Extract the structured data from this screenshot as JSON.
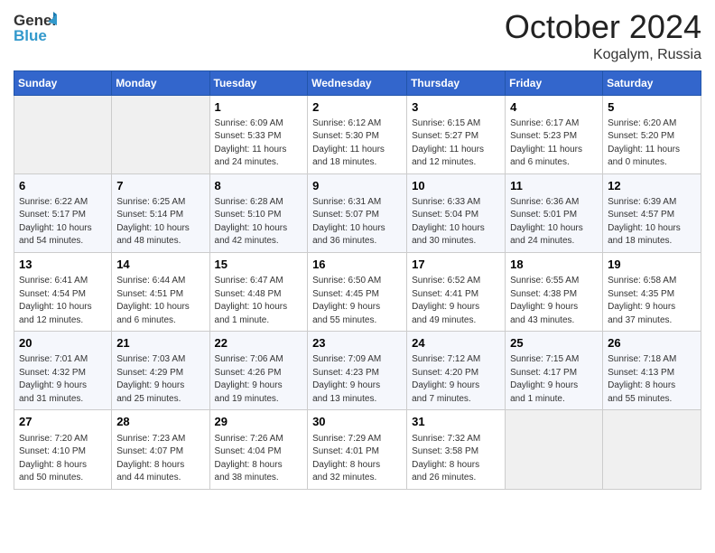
{
  "header": {
    "logo_general": "General",
    "logo_blue": "Blue",
    "month_title": "October 2024",
    "location": "Kogalym, Russia"
  },
  "weekdays": [
    "Sunday",
    "Monday",
    "Tuesday",
    "Wednesday",
    "Thursday",
    "Friday",
    "Saturday"
  ],
  "weeks": [
    [
      {
        "day": "",
        "detail": ""
      },
      {
        "day": "",
        "detail": ""
      },
      {
        "day": "1",
        "detail": "Sunrise: 6:09 AM\nSunset: 5:33 PM\nDaylight: 11 hours\nand 24 minutes."
      },
      {
        "day": "2",
        "detail": "Sunrise: 6:12 AM\nSunset: 5:30 PM\nDaylight: 11 hours\nand 18 minutes."
      },
      {
        "day": "3",
        "detail": "Sunrise: 6:15 AM\nSunset: 5:27 PM\nDaylight: 11 hours\nand 12 minutes."
      },
      {
        "day": "4",
        "detail": "Sunrise: 6:17 AM\nSunset: 5:23 PM\nDaylight: 11 hours\nand 6 minutes."
      },
      {
        "day": "5",
        "detail": "Sunrise: 6:20 AM\nSunset: 5:20 PM\nDaylight: 11 hours\nand 0 minutes."
      }
    ],
    [
      {
        "day": "6",
        "detail": "Sunrise: 6:22 AM\nSunset: 5:17 PM\nDaylight: 10 hours\nand 54 minutes."
      },
      {
        "day": "7",
        "detail": "Sunrise: 6:25 AM\nSunset: 5:14 PM\nDaylight: 10 hours\nand 48 minutes."
      },
      {
        "day": "8",
        "detail": "Sunrise: 6:28 AM\nSunset: 5:10 PM\nDaylight: 10 hours\nand 42 minutes."
      },
      {
        "day": "9",
        "detail": "Sunrise: 6:31 AM\nSunset: 5:07 PM\nDaylight: 10 hours\nand 36 minutes."
      },
      {
        "day": "10",
        "detail": "Sunrise: 6:33 AM\nSunset: 5:04 PM\nDaylight: 10 hours\nand 30 minutes."
      },
      {
        "day": "11",
        "detail": "Sunrise: 6:36 AM\nSunset: 5:01 PM\nDaylight: 10 hours\nand 24 minutes."
      },
      {
        "day": "12",
        "detail": "Sunrise: 6:39 AM\nSunset: 4:57 PM\nDaylight: 10 hours\nand 18 minutes."
      }
    ],
    [
      {
        "day": "13",
        "detail": "Sunrise: 6:41 AM\nSunset: 4:54 PM\nDaylight: 10 hours\nand 12 minutes."
      },
      {
        "day": "14",
        "detail": "Sunrise: 6:44 AM\nSunset: 4:51 PM\nDaylight: 10 hours\nand 6 minutes."
      },
      {
        "day": "15",
        "detail": "Sunrise: 6:47 AM\nSunset: 4:48 PM\nDaylight: 10 hours\nand 1 minute."
      },
      {
        "day": "16",
        "detail": "Sunrise: 6:50 AM\nSunset: 4:45 PM\nDaylight: 9 hours\nand 55 minutes."
      },
      {
        "day": "17",
        "detail": "Sunrise: 6:52 AM\nSunset: 4:41 PM\nDaylight: 9 hours\nand 49 minutes."
      },
      {
        "day": "18",
        "detail": "Sunrise: 6:55 AM\nSunset: 4:38 PM\nDaylight: 9 hours\nand 43 minutes."
      },
      {
        "day": "19",
        "detail": "Sunrise: 6:58 AM\nSunset: 4:35 PM\nDaylight: 9 hours\nand 37 minutes."
      }
    ],
    [
      {
        "day": "20",
        "detail": "Sunrise: 7:01 AM\nSunset: 4:32 PM\nDaylight: 9 hours\nand 31 minutes."
      },
      {
        "day": "21",
        "detail": "Sunrise: 7:03 AM\nSunset: 4:29 PM\nDaylight: 9 hours\nand 25 minutes."
      },
      {
        "day": "22",
        "detail": "Sunrise: 7:06 AM\nSunset: 4:26 PM\nDaylight: 9 hours\nand 19 minutes."
      },
      {
        "day": "23",
        "detail": "Sunrise: 7:09 AM\nSunset: 4:23 PM\nDaylight: 9 hours\nand 13 minutes."
      },
      {
        "day": "24",
        "detail": "Sunrise: 7:12 AM\nSunset: 4:20 PM\nDaylight: 9 hours\nand 7 minutes."
      },
      {
        "day": "25",
        "detail": "Sunrise: 7:15 AM\nSunset: 4:17 PM\nDaylight: 9 hours\nand 1 minute."
      },
      {
        "day": "26",
        "detail": "Sunrise: 7:18 AM\nSunset: 4:13 PM\nDaylight: 8 hours\nand 55 minutes."
      }
    ],
    [
      {
        "day": "27",
        "detail": "Sunrise: 7:20 AM\nSunset: 4:10 PM\nDaylight: 8 hours\nand 50 minutes."
      },
      {
        "day": "28",
        "detail": "Sunrise: 7:23 AM\nSunset: 4:07 PM\nDaylight: 8 hours\nand 44 minutes."
      },
      {
        "day": "29",
        "detail": "Sunrise: 7:26 AM\nSunset: 4:04 PM\nDaylight: 8 hours\nand 38 minutes."
      },
      {
        "day": "30",
        "detail": "Sunrise: 7:29 AM\nSunset: 4:01 PM\nDaylight: 8 hours\nand 32 minutes."
      },
      {
        "day": "31",
        "detail": "Sunrise: 7:32 AM\nSunset: 3:58 PM\nDaylight: 8 hours\nand 26 minutes."
      },
      {
        "day": "",
        "detail": ""
      },
      {
        "day": "",
        "detail": ""
      }
    ]
  ]
}
